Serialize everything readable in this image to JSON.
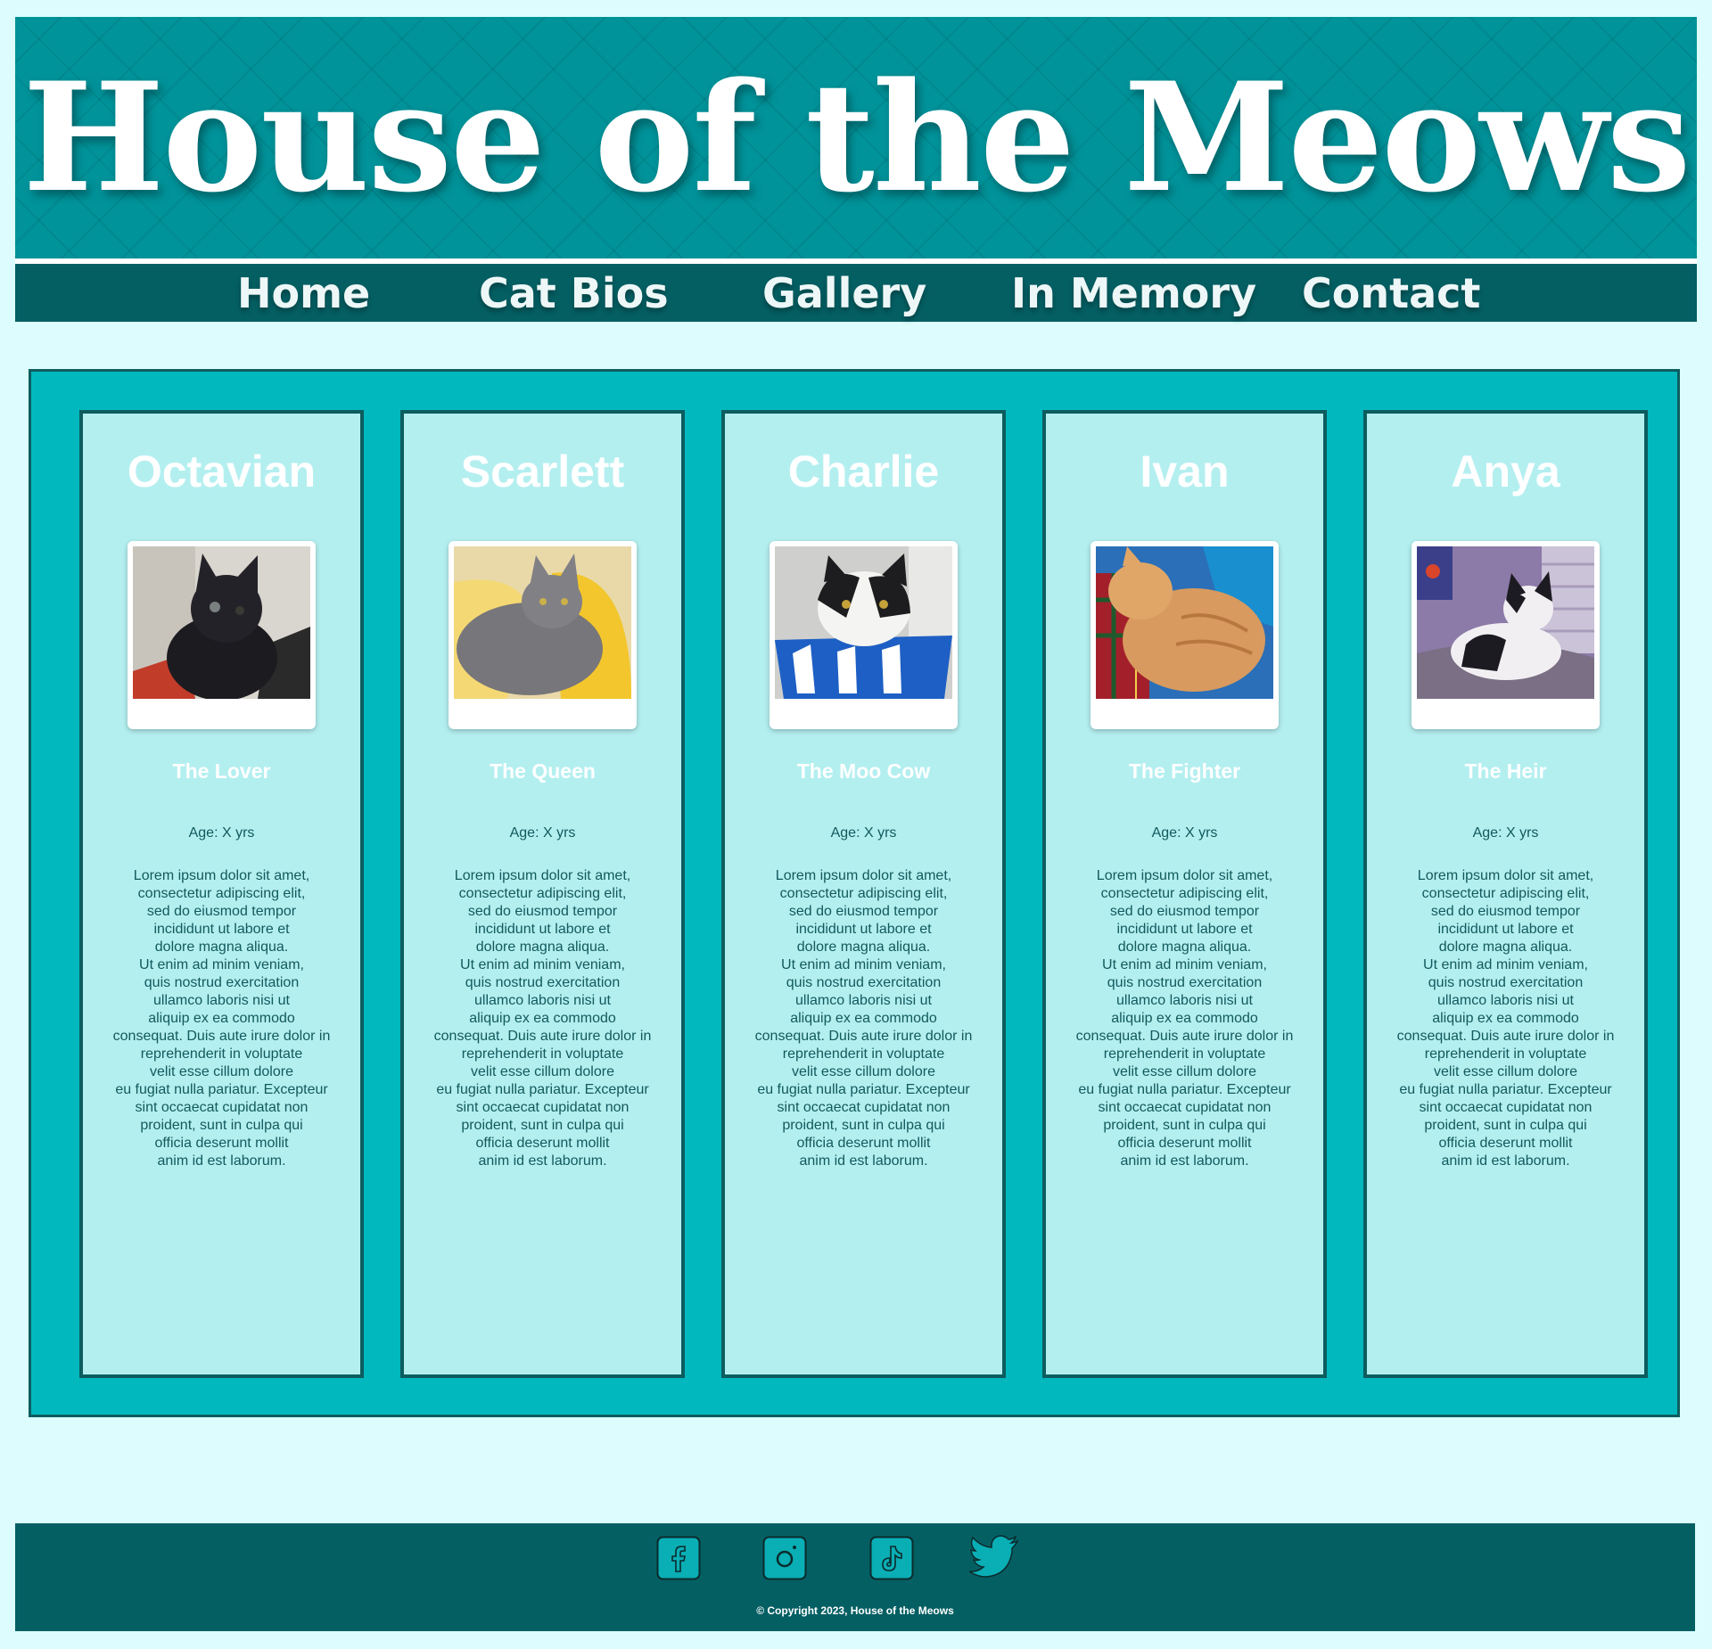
{
  "header": {
    "site_title": "House of the Meows"
  },
  "nav": {
    "items": [
      {
        "label": "Home"
      },
      {
        "label": "Cat Bios"
      },
      {
        "label": "Gallery"
      },
      {
        "label": "In Memory"
      },
      {
        "label": "Contact"
      }
    ]
  },
  "colors": {
    "page_background": "#dcfcfd",
    "header_teal": "#01939a",
    "nav_dark_teal": "#045f63",
    "panel_teal": "#02b8bf",
    "card_background": "#b4eff0",
    "card_border": "#0d5d5f"
  },
  "cats": [
    {
      "name": "Octavian",
      "title": "The Lover",
      "age": "Age: X yrs",
      "photo_icon": "black-cat-photo",
      "bio": "Lorem ipsum dolor sit amet,\nconsectetur adipiscing elit,\nsed do eiusmod tempor\nincididunt ut labore et\ndolore magna aliqua.\nUt enim ad minim veniam,\nquis nostrud exercitation\nullamco laboris nisi ut\naliquip ex ea commodo\nconsequat. Duis aute irure dolor in\nreprehenderit in voluptate\nvelit esse cillum dolore\neu fugiat nulla pariatur. Excepteur\nsint occaecat cupidatat non\nproident, sunt in culpa qui\nofficia deserunt mollit\nanim id est laborum."
    },
    {
      "name": "Scarlett",
      "title": "The Queen",
      "age": "Age: X yrs",
      "photo_icon": "grey-cat-photo",
      "bio": "Lorem ipsum dolor sit amet,\nconsectetur adipiscing elit,\nsed do eiusmod tempor\nincididunt ut labore et\ndolore magna aliqua.\nUt enim ad minim veniam,\nquis nostrud exercitation\nullamco laboris nisi ut\naliquip ex ea commodo\nconsequat. Duis aute irure dolor in\nreprehenderit in voluptate\nvelit esse cillum dolore\neu fugiat nulla pariatur. Excepteur\nsint occaecat cupidatat non\nproident, sunt in culpa qui\nofficia deserunt mollit\nanim id est laborum."
    },
    {
      "name": "Charlie",
      "title": "The Moo Cow",
      "age": "Age: X yrs",
      "photo_icon": "tuxedo-cat-in-basket-photo",
      "bio": "Lorem ipsum dolor sit amet,\nconsectetur adipiscing elit,\nsed do eiusmod tempor\nincididunt ut labore et\ndolore magna aliqua.\nUt enim ad minim veniam,\nquis nostrud exercitation\nullamco laboris nisi ut\naliquip ex ea commodo\nconsequat. Duis aute irure dolor in\nreprehenderit in voluptate\nvelit esse cillum dolore\neu fugiat nulla pariatur. Excepteur\nsint occaecat cupidatat non\nproident, sunt in culpa qui\nofficia deserunt mollit\nanim id est laborum."
    },
    {
      "name": "Ivan",
      "title": "The Fighter",
      "age": "Age: X yrs",
      "photo_icon": "orange-cat-sleeping-photo",
      "bio": "Lorem ipsum dolor sit amet,\nconsectetur adipiscing elit,\nsed do eiusmod tempor\nincididunt ut labore et\ndolore magna aliqua.\nUt enim ad minim veniam,\nquis nostrud exercitation\nullamco laboris nisi ut\naliquip ex ea commodo\nconsequat. Duis aute irure dolor in\nreprehenderit in voluptate\nvelit esse cillum dolore\neu fugiat nulla pariatur. Excepteur\nsint occaecat cupidatat non\nproident, sunt in culpa qui\nofficia deserunt mollit\nanim id est laborum."
    },
    {
      "name": "Anya",
      "title": "The Heir",
      "age": "Age: X yrs",
      "photo_icon": "black-white-cat-in-bed-photo",
      "bio": "Lorem ipsum dolor sit amet,\nconsectetur adipiscing elit,\nsed do eiusmod tempor\nincididunt ut labore et\ndolore magna aliqua.\nUt enim ad minim veniam,\nquis nostrud exercitation\nullamco laboris nisi ut\naliquip ex ea commodo\nconsequat. Duis aute irure dolor in\nreprehenderit in voluptate\nvelit esse cillum dolore\neu fugiat nulla pariatur. Excepteur\nsint occaecat cupidatat non\nproident, sunt in culpa qui\nofficia deserunt mollit\nanim id est laborum."
    }
  ],
  "footer": {
    "social_icons": [
      "facebook-icon",
      "instagram-icon",
      "tiktok-icon",
      "twitter-icon"
    ],
    "copyright": "© Copyright 2023, House of the Meows"
  }
}
